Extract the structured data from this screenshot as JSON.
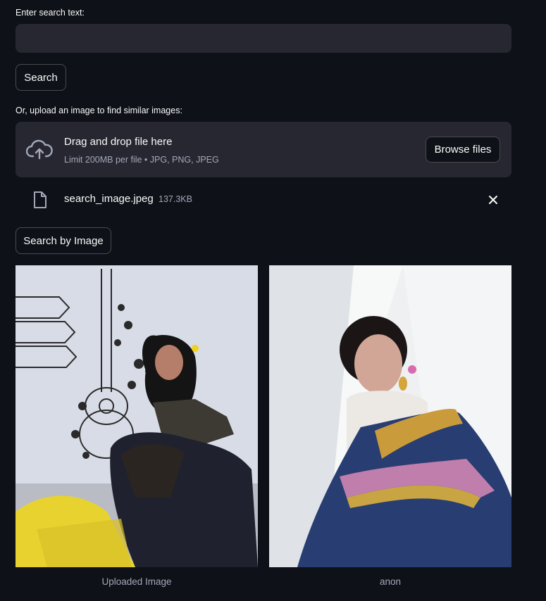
{
  "search": {
    "label": "Enter search text:",
    "value": "",
    "placeholder": "",
    "button_label": "Search"
  },
  "upload": {
    "label": "Or, upload an image to find similar images:",
    "dropzone_title": "Drag and drop file here",
    "dropzone_limits": "Limit 200MB per file • JPG, PNG, JPEG",
    "browse_label": "Browse files",
    "file_name": "search_image.jpeg",
    "file_size": "137.3KB",
    "image_search_button_label": "Search by Image"
  },
  "results": [
    {
      "caption": "Uploaded Image",
      "icon": "photo-woman-graffiti-wall"
    },
    {
      "caption": "anon",
      "icon": "photo-woman-blue-saree"
    }
  ],
  "colors": {
    "background": "#0e1117",
    "input_bg": "#262730",
    "muted_text": "#a3a8b8"
  }
}
